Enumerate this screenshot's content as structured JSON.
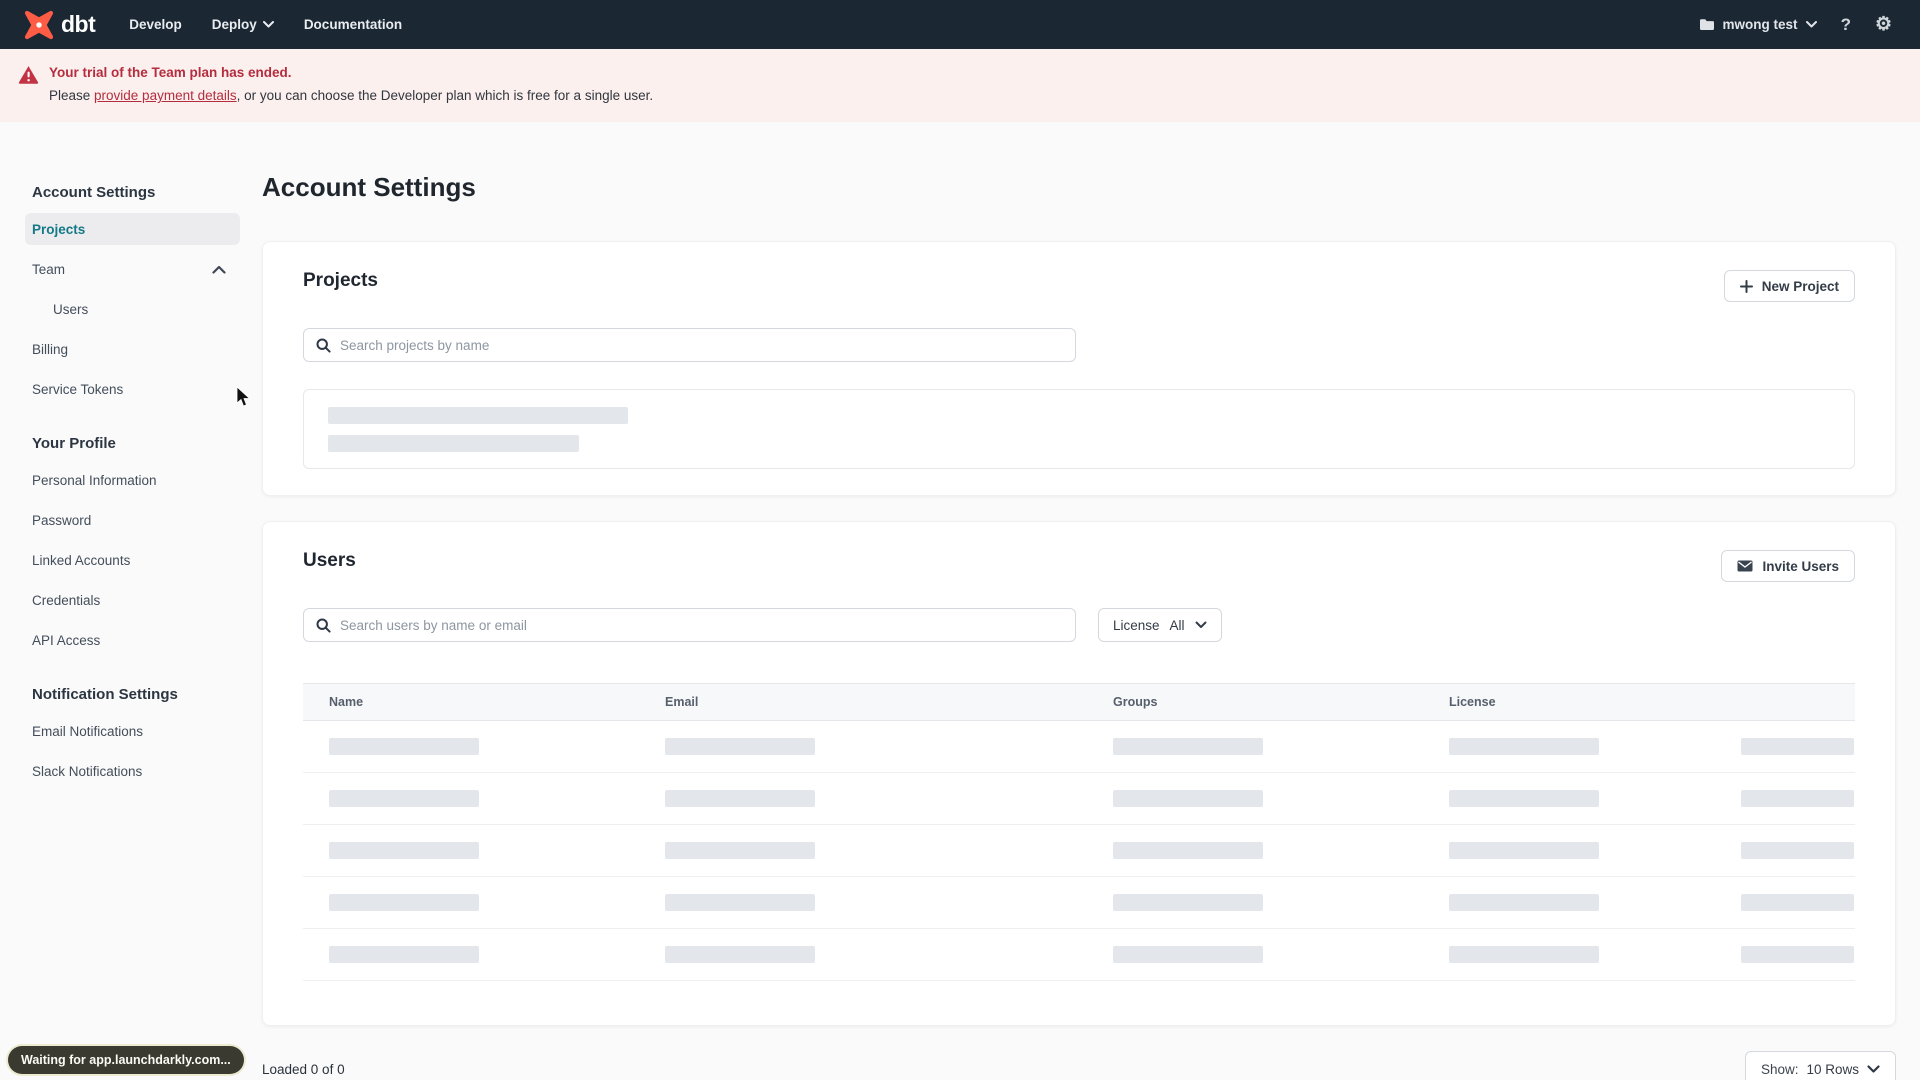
{
  "nav": {
    "brand": "dbt",
    "items": [
      {
        "label": "Develop"
      },
      {
        "label": "Deploy"
      },
      {
        "label": "Documentation"
      }
    ],
    "account_label": "mwong test",
    "help_glyph": "?",
    "gear_glyph": "⚙"
  },
  "banner": {
    "title": "Your trial of the Team plan has ended.",
    "body_prefix": "Please ",
    "link_text": "provide payment details",
    "body_suffix": ", or you can choose the Developer plan which is free for a single user."
  },
  "sidebar": {
    "sections": [
      {
        "header": "Account Settings",
        "items": [
          {
            "label": "Projects"
          },
          {
            "label": "Team"
          },
          {
            "label": "Users"
          },
          {
            "label": "Billing"
          },
          {
            "label": "Service Tokens"
          }
        ]
      },
      {
        "header": "Your Profile",
        "items": [
          {
            "label": "Personal Information"
          },
          {
            "label": "Password"
          },
          {
            "label": "Linked Accounts"
          },
          {
            "label": "Credentials"
          },
          {
            "label": "API Access"
          }
        ]
      },
      {
        "header": "Notification Settings",
        "items": [
          {
            "label": "Email Notifications"
          },
          {
            "label": "Slack Notifications"
          }
        ]
      }
    ]
  },
  "main": {
    "title": "Account Settings",
    "projects_card": {
      "title": "Projects",
      "new_project_label": "New Project",
      "search_placeholder": "Search projects by name"
    },
    "users_card": {
      "title": "Users",
      "invite_label": "Invite Users",
      "search_placeholder": "Search users by name or email",
      "license_filter": {
        "label": "License",
        "value": "All"
      },
      "table": {
        "columns": [
          "Name",
          "Email",
          "Groups",
          "License"
        ],
        "skeleton_rows": 5
      }
    },
    "footer": {
      "loaded_text": "Loaded 0 of 0",
      "show_label": "Show:",
      "show_value": "10 Rows"
    }
  },
  "status_bubble_text": "Waiting for app.launchdarkly.com...",
  "colors": {
    "brand_orange": "#ff5c45",
    "nav_bg": "#1b2733",
    "banner_bg": "#fcf0ef",
    "alert_red": "#b42d3e",
    "selected_teal": "#157987",
    "skeleton_gray": "#e3e6ea"
  }
}
